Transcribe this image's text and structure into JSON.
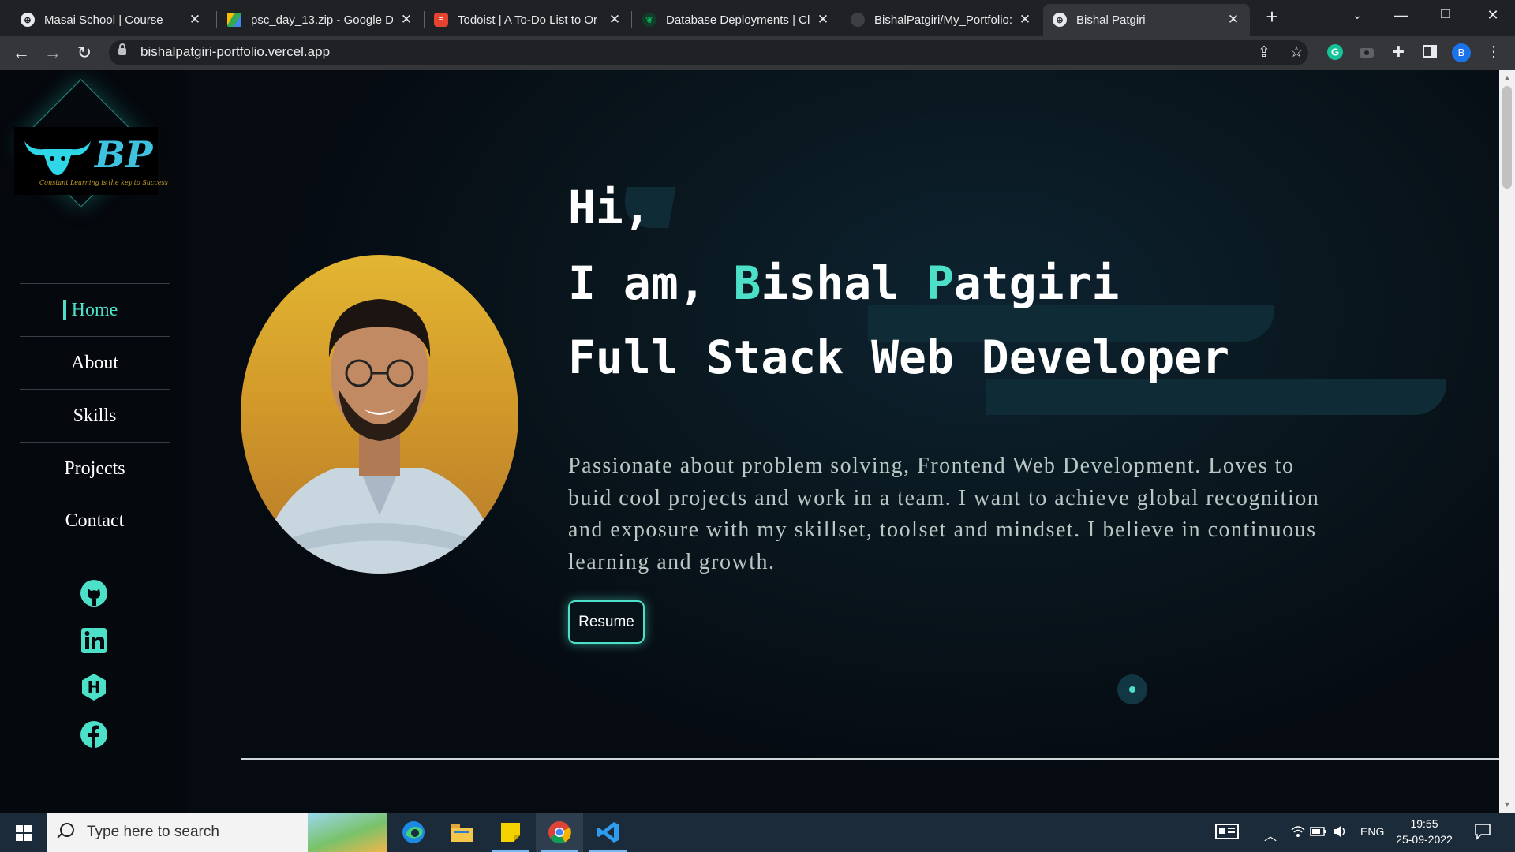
{
  "browser": {
    "tabs": [
      {
        "title": "Masai School | Course",
        "favicon": "globe-icon",
        "active": false
      },
      {
        "title": "psc_day_13.zip - Google Dr",
        "favicon": "google-drive-icon",
        "active": false
      },
      {
        "title": "Todoist | A To-Do List to Or",
        "favicon": "todoist-icon",
        "active": false
      },
      {
        "title": "Database Deployments | Cl",
        "favicon": "mongodb-leaf-icon",
        "active": false
      },
      {
        "title": "BishalPatgiri/My_Portfolio: ",
        "favicon": "github-icon",
        "active": false
      },
      {
        "title": "Bishal Patgiri",
        "favicon": "globe-icon",
        "active": true
      }
    ],
    "new_tab_label": "+",
    "url": "bishalpatgiri-portfolio.vercel.app",
    "profile_initial": "B"
  },
  "sidebar": {
    "logo": {
      "text": "BP",
      "tagline": "Constant Learning is the key to Success"
    },
    "nav": [
      {
        "label": "Home",
        "active": true
      },
      {
        "label": "About",
        "active": false
      },
      {
        "label": "Skills",
        "active": false
      },
      {
        "label": "Projects",
        "active": false
      },
      {
        "label": "Contact",
        "active": false
      }
    ],
    "social": [
      "github-icon",
      "linkedin-icon",
      "hashnode-icon",
      "facebook-icon"
    ]
  },
  "hero": {
    "greeting": "Hi,",
    "intro_prefix": "I am, ",
    "first_initial": "B",
    "first_rest": "ishal ",
    "last_initial": "P",
    "last_rest": "atgiri",
    "role": "Full Stack Web Developer",
    "bio": "Passionate about problem solving, Frontend Web Development. Loves to buid cool projects and work in a team. I want to achieve global recognition and exposure with my skillset, toolset and mindset. I believe in continuous learning and growth.",
    "resume_label": "Resume"
  },
  "colors": {
    "accent": "#4ce0c8",
    "background": "#0a1820",
    "sidebar": "#05080d"
  },
  "taskbar": {
    "search_placeholder": "Type here to search",
    "apps": [
      "edge-icon",
      "file-explorer-icon",
      "sticky-notes-icon",
      "chrome-icon",
      "vscode-icon"
    ],
    "language": "ENG",
    "time": "19:55",
    "date": "25-09-2022"
  }
}
